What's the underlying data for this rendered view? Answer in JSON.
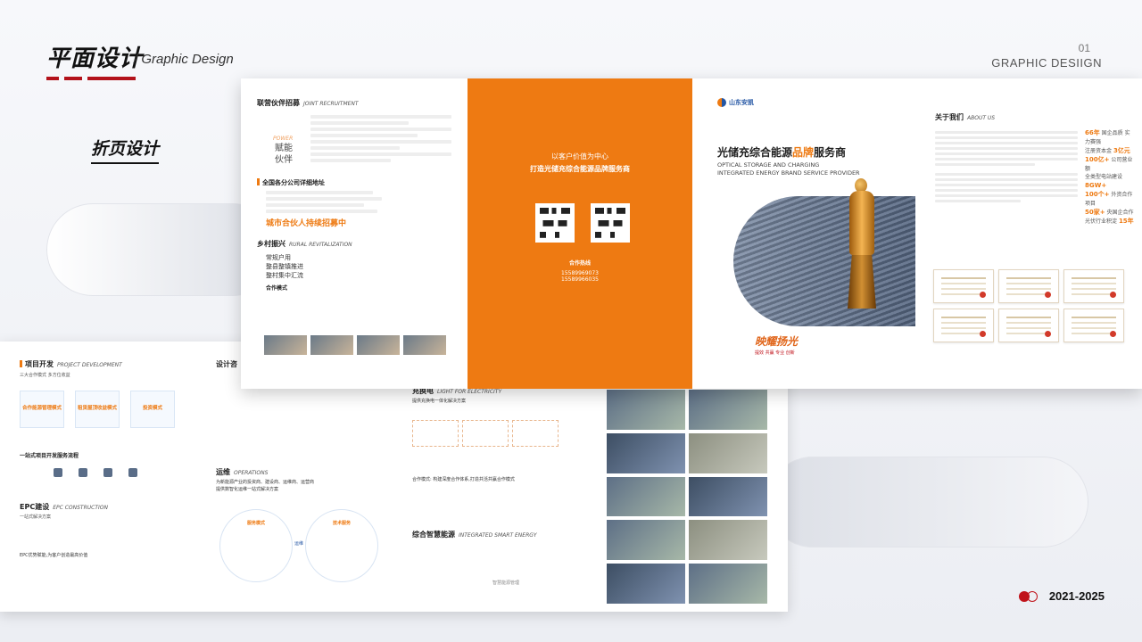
{
  "header": {
    "title": "平面设计",
    "subtitle": "/ Graphic Design",
    "page_number": "01",
    "english_title": "GRAPHIC DESIIGN",
    "accent_color": "#b3121a"
  },
  "section_label": "折页设计",
  "footer": {
    "year_range": "2021-2025",
    "icon": "double-circle-icon"
  },
  "brochure_front": {
    "panel1": {
      "recruit_title": "联营伙伴招募",
      "recruit_en": "JOINT RECRUITMENT",
      "power_en": "POWER",
      "empower_word1": "赋能",
      "empower_word2": "伙伴",
      "branches_title": "全国各分公司详细地址",
      "city_cta": "城市合伙人持续招募中",
      "rural_title": "乡村振兴",
      "rural_en": "RURAL REVITALIZATION",
      "rural_items": [
        "常规户用",
        "整县整镇推进",
        "整村集中汇流"
      ],
      "coop_title": "合作模式"
    },
    "panel2": {
      "slogan_line1": "以客户价值为中心",
      "slogan_line2": "打造光储充综合能源品牌服务商",
      "hotline_label": "合作热线",
      "phone1": "15589969073",
      "phone2": "15589966035",
      "brand_color": "#ee7a12"
    },
    "panel3": {
      "logo_text": "山东安凯",
      "headline_part1": "光储充综合能源",
      "headline_highlight": "品牌",
      "headline_part2": "服务商",
      "en_line1": "OPTICAL STORAGE AND CHARGING",
      "en_line2": "INTEGRATED ENERGY BRAND SERVICE PROVIDER",
      "calligraphy": "映耀扬光",
      "calligraphy_sub": "提效 共赢 专业 创新"
    },
    "panel4": {
      "about_title": "关于我们",
      "about_en": "ABOUT US",
      "stats": [
        {
          "value": "66年",
          "label": "国企品质 实力赛强"
        },
        {
          "value": "3亿元",
          "label": "注册资本金"
        },
        {
          "value": "100亿+",
          "label": "公司营业额"
        },
        {
          "value": "8GW+",
          "label": "全类型电站建设"
        },
        {
          "value": "100个+",
          "label": "外资合作项目"
        },
        {
          "value": "50家+",
          "label": "央国企合作"
        },
        {
          "value": "15年",
          "label": "光伏行业积淀"
        }
      ]
    }
  },
  "brochure_back": {
    "panel1": {
      "dev_title": "项目开发",
      "dev_en": "PROJECT DEVELOPMENT",
      "dev_sub": "三大合作模式 多方位收益",
      "boxes": [
        "合作能源管理模式",
        "租赁屋顶收益模式",
        "投资模式"
      ],
      "one_stop": "一站式项目开发服务流程",
      "epc_title": "EPC建设",
      "epc_en": "EPC CONSTRUCTION",
      "epc_sub": "一站式解决方案",
      "epc_bottom": "EPC优势赋能,为客户创造最高价值"
    },
    "panel2": {
      "design_title": "设计咨",
      "ops_title": "运维",
      "ops_en": "OPERATIONS",
      "ops_sub1": "为新能源产业的投资商、建设商、运维商、运营商",
      "ops_sub2": "提供数智化运维一站式解决方案",
      "ring1_title": "服务模式",
      "ring2_title": "技术服务",
      "ring_center": "运维"
    },
    "panel3": {
      "charge_title": "充换电",
      "charge_en": "LIGHT FOR ELECTRICITY",
      "charge_sub": "提供充换电一体化解决方案",
      "coop_mode": "合作模式: 构建深度合作体系,打造共活共赢合作模式",
      "smart_title": "综合智慧能源",
      "smart_en": "INTEGRATED SMART ENERGY",
      "smart_caption": "智慧能源管理"
    }
  }
}
